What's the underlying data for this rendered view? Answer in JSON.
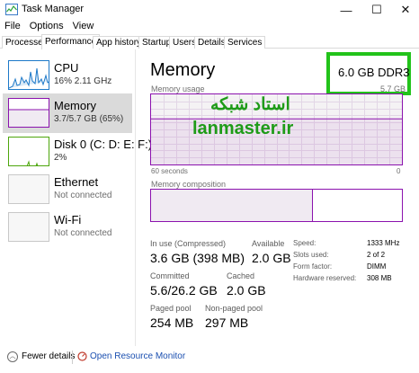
{
  "window": {
    "title": "Task Manager",
    "minimize_glyph": "—",
    "maximize_glyph": "☐",
    "close_glyph": "✕"
  },
  "menu": [
    "File",
    "Options",
    "View"
  ],
  "tabs": [
    {
      "label": "Processes",
      "active": false
    },
    {
      "label": "Performance",
      "active": true
    },
    {
      "label": "App history",
      "active": false
    },
    {
      "label": "Startup",
      "active": false
    },
    {
      "label": "Users",
      "active": false
    },
    {
      "label": "Details",
      "active": false
    },
    {
      "label": "Services",
      "active": false
    }
  ],
  "sidebar": {
    "items": [
      {
        "title": "CPU",
        "subtitle": "16%  2.11 GHz",
        "color": "#1c78c8"
      },
      {
        "title": "Memory",
        "subtitle": "3.7/5.7 GB (65%)",
        "color": "#8b12ae",
        "selected": true
      },
      {
        "title": "Disk 0 (C: D: E: F:)",
        "subtitle": "2%",
        "color": "#4da60c"
      },
      {
        "title": "Ethernet",
        "subtitle": "Not connected",
        "color": "#a0a0a0"
      },
      {
        "title": "Wi-Fi",
        "subtitle": "Not connected",
        "color": "#a0a0a0"
      }
    ]
  },
  "memory": {
    "title": "Memory",
    "spec": "6.0 GB DDR3",
    "usage_label": "Memory usage",
    "usage_max": "5.7 GB",
    "seconds_label": "60 seconds",
    "zero_label": "0",
    "composition_label": "Memory composition",
    "usage_fraction": 0.65,
    "graph_color": "#8b12ae",
    "stats": {
      "in_use_label": "In use (Compressed)",
      "in_use_value": "3.6 GB (398 MB)",
      "available_label": "Available",
      "available_value": "2.0 GB",
      "committed_label": "Committed",
      "committed_value": "5.6/26.2 GB",
      "cached_label": "Cached",
      "cached_value": "2.0 GB",
      "paged_label": "Paged pool",
      "paged_value": "254 MB",
      "nonpaged_label": "Non-paged pool",
      "nonpaged_value": "297 MB"
    },
    "details": [
      {
        "label": "Speed:",
        "value": "1333 MHz"
      },
      {
        "label": "Slots used:",
        "value": "2 of 2"
      },
      {
        "label": "Form factor:",
        "value": "DIMM"
      },
      {
        "label": "Hardware reserved:",
        "value": "308 MB"
      }
    ]
  },
  "watermark": {
    "persian": "استاد شبکه",
    "site": "lanmaster.ir",
    "color": "#1e9b18"
  },
  "footer": {
    "fewer_details": "Fewer details",
    "open_monitor": "Open Resource Monitor"
  }
}
